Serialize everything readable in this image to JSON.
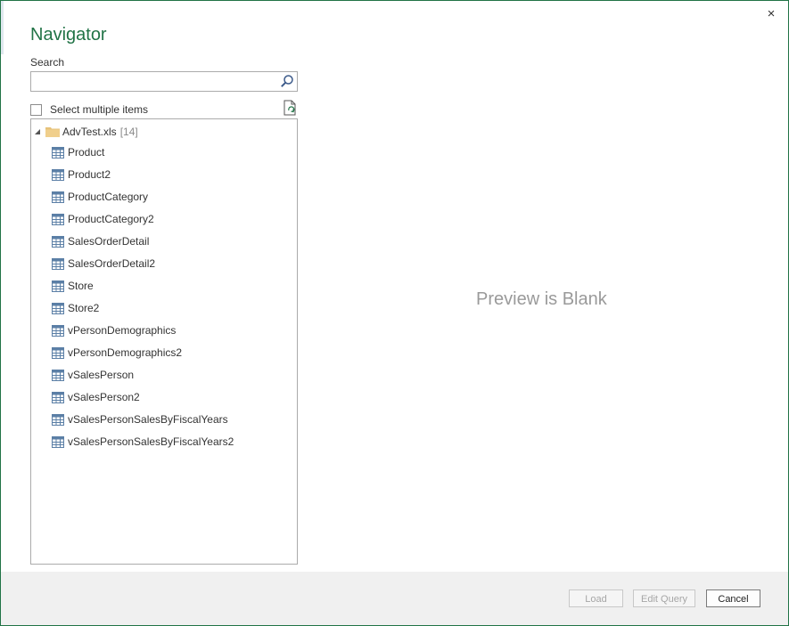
{
  "dialog": {
    "title": "Navigator",
    "close_label": "×"
  },
  "search": {
    "label": "Search",
    "value": "",
    "placeholder": ""
  },
  "multi_select": {
    "label": "Select multiple items",
    "checked": false
  },
  "tree": {
    "root": {
      "label": "AdvTest.xls",
      "count": "[14]",
      "expanded": true
    },
    "items": [
      {
        "label": "Product"
      },
      {
        "label": "Product2"
      },
      {
        "label": "ProductCategory"
      },
      {
        "label": "ProductCategory2"
      },
      {
        "label": "SalesOrderDetail"
      },
      {
        "label": "SalesOrderDetail2"
      },
      {
        "label": "Store"
      },
      {
        "label": "Store2"
      },
      {
        "label": "vPersonDemographics"
      },
      {
        "label": "vPersonDemographics2"
      },
      {
        "label": "vSalesPerson"
      },
      {
        "label": "vSalesPerson2"
      },
      {
        "label": "vSalesPersonSalesByFiscalYears"
      },
      {
        "label": "vSalesPersonSalesByFiscalYears2"
      }
    ]
  },
  "preview": {
    "text": "Preview is Blank"
  },
  "footer": {
    "load_label": "Load",
    "edit_label": "Edit Query",
    "cancel_label": "Cancel"
  },
  "colors": {
    "accent": "#217346",
    "folder": "#e6c27a",
    "table_icon": "#5b7fa6"
  }
}
